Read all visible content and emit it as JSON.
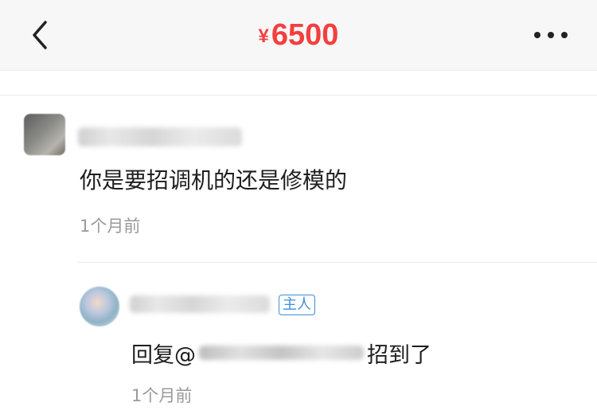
{
  "header": {
    "currency_symbol": "¥",
    "price": "6500",
    "back_icon": "chevron-left-icon",
    "more_icon": "ellipsis-icon"
  },
  "comments": [
    {
      "author": "",
      "text": "你是要招调机的还是修模的",
      "time": "1个月前"
    }
  ],
  "reply": {
    "author": "",
    "badge": "主人",
    "prefix": "回复@",
    "suffix": "招到了",
    "time": "1个月前"
  },
  "colors": {
    "price": "#f2403f",
    "badge": "#3d8ed8",
    "secondary_text": "#9a9a9a"
  }
}
